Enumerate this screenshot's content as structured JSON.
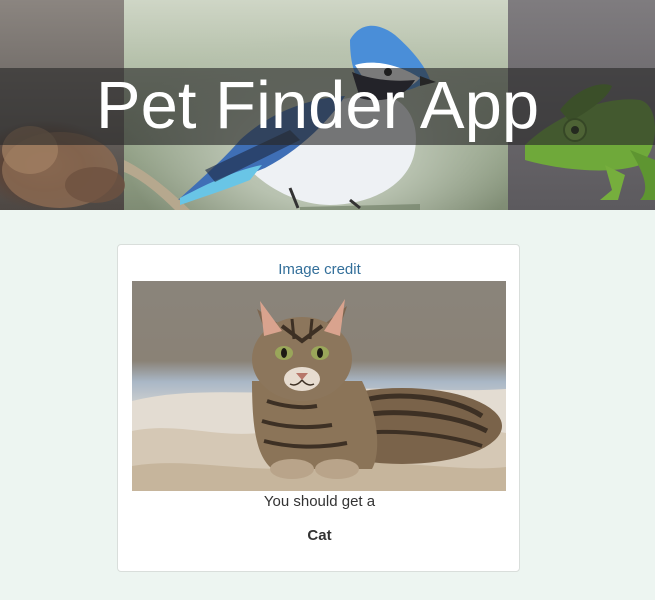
{
  "app": {
    "title": "Pet Finder App"
  },
  "banner": {
    "image_description": "collage of a cat, a blue jay and a chameleon"
  },
  "result_card": {
    "credit_link_label": "Image credit",
    "photo_subject": "cat",
    "intro_text": "You should get a",
    "pet_name": "Cat"
  },
  "colors": {
    "page_background": "#edf5f1",
    "link_color": "#336f9a",
    "title_text": "#ffffff",
    "title_strip": "rgba(40,40,40,0.62)",
    "card_border": "#d9dedb",
    "body_text": "#333333"
  }
}
